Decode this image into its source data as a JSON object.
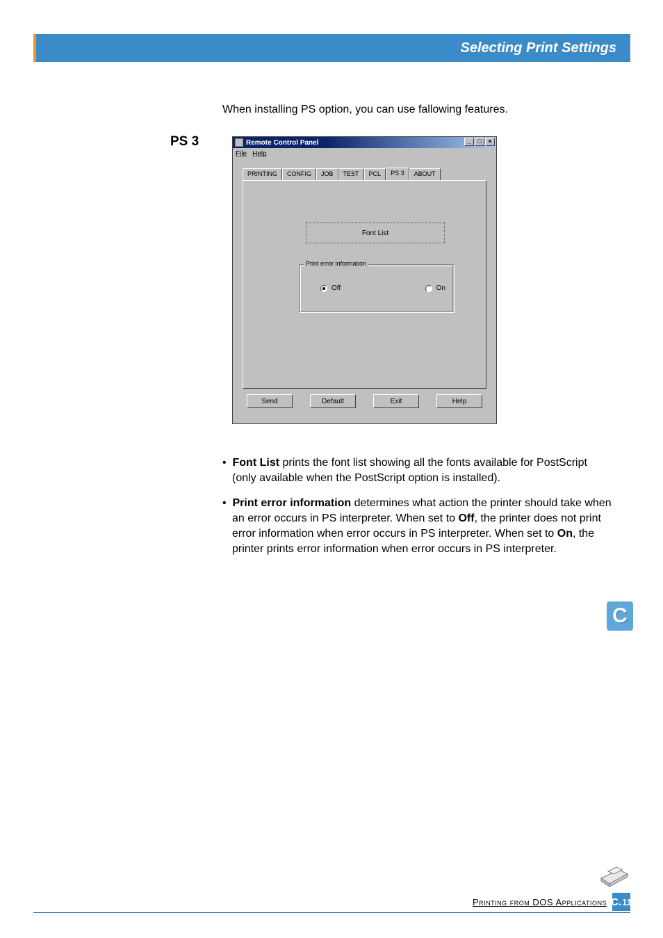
{
  "header": {
    "title": "Selecting Print Settings"
  },
  "intro": "When installing PS option, you can use fallowing features.",
  "section_label": "PS 3",
  "window": {
    "title": "Remote Control Panel",
    "menu": {
      "file": "File",
      "help": "Help"
    },
    "sys": {
      "min": "_",
      "max": "□",
      "close": "×"
    },
    "tabs": [
      "PRINTING",
      "CONFIG",
      "JOB",
      "TEST",
      "PCL",
      "PS 3",
      "ABOUT"
    ],
    "active_tab_index": 5,
    "font_list_btn": "Font List",
    "group_title": "Print error information",
    "radio": {
      "off": "Off",
      "on": "On",
      "selected": "off"
    },
    "buttons": {
      "send": "Send",
      "default": "Default",
      "exit": "Exit",
      "help": "Help"
    }
  },
  "bullets": {
    "b1_strong": "Font List",
    "b1_rest": " prints the font list showing all the fonts available for PostScript (only available when the PostScript option is installed).",
    "b2_strong": "Print error information",
    "b2_mid1": " determines what action the printer should take when an error occurs in PS interpreter. When set to ",
    "b2_off": "Off",
    "b2_mid2": ", the printer does not print error information when error occurs in PS interpreter. When set to ",
    "b2_on": "On",
    "b2_mid3": ", the printer prints error information when error occurs in PS interpreter."
  },
  "side_tab": "C",
  "footer": {
    "text": "Printing from DOS Applications",
    "badge_letter": "C.",
    "page": "11"
  }
}
